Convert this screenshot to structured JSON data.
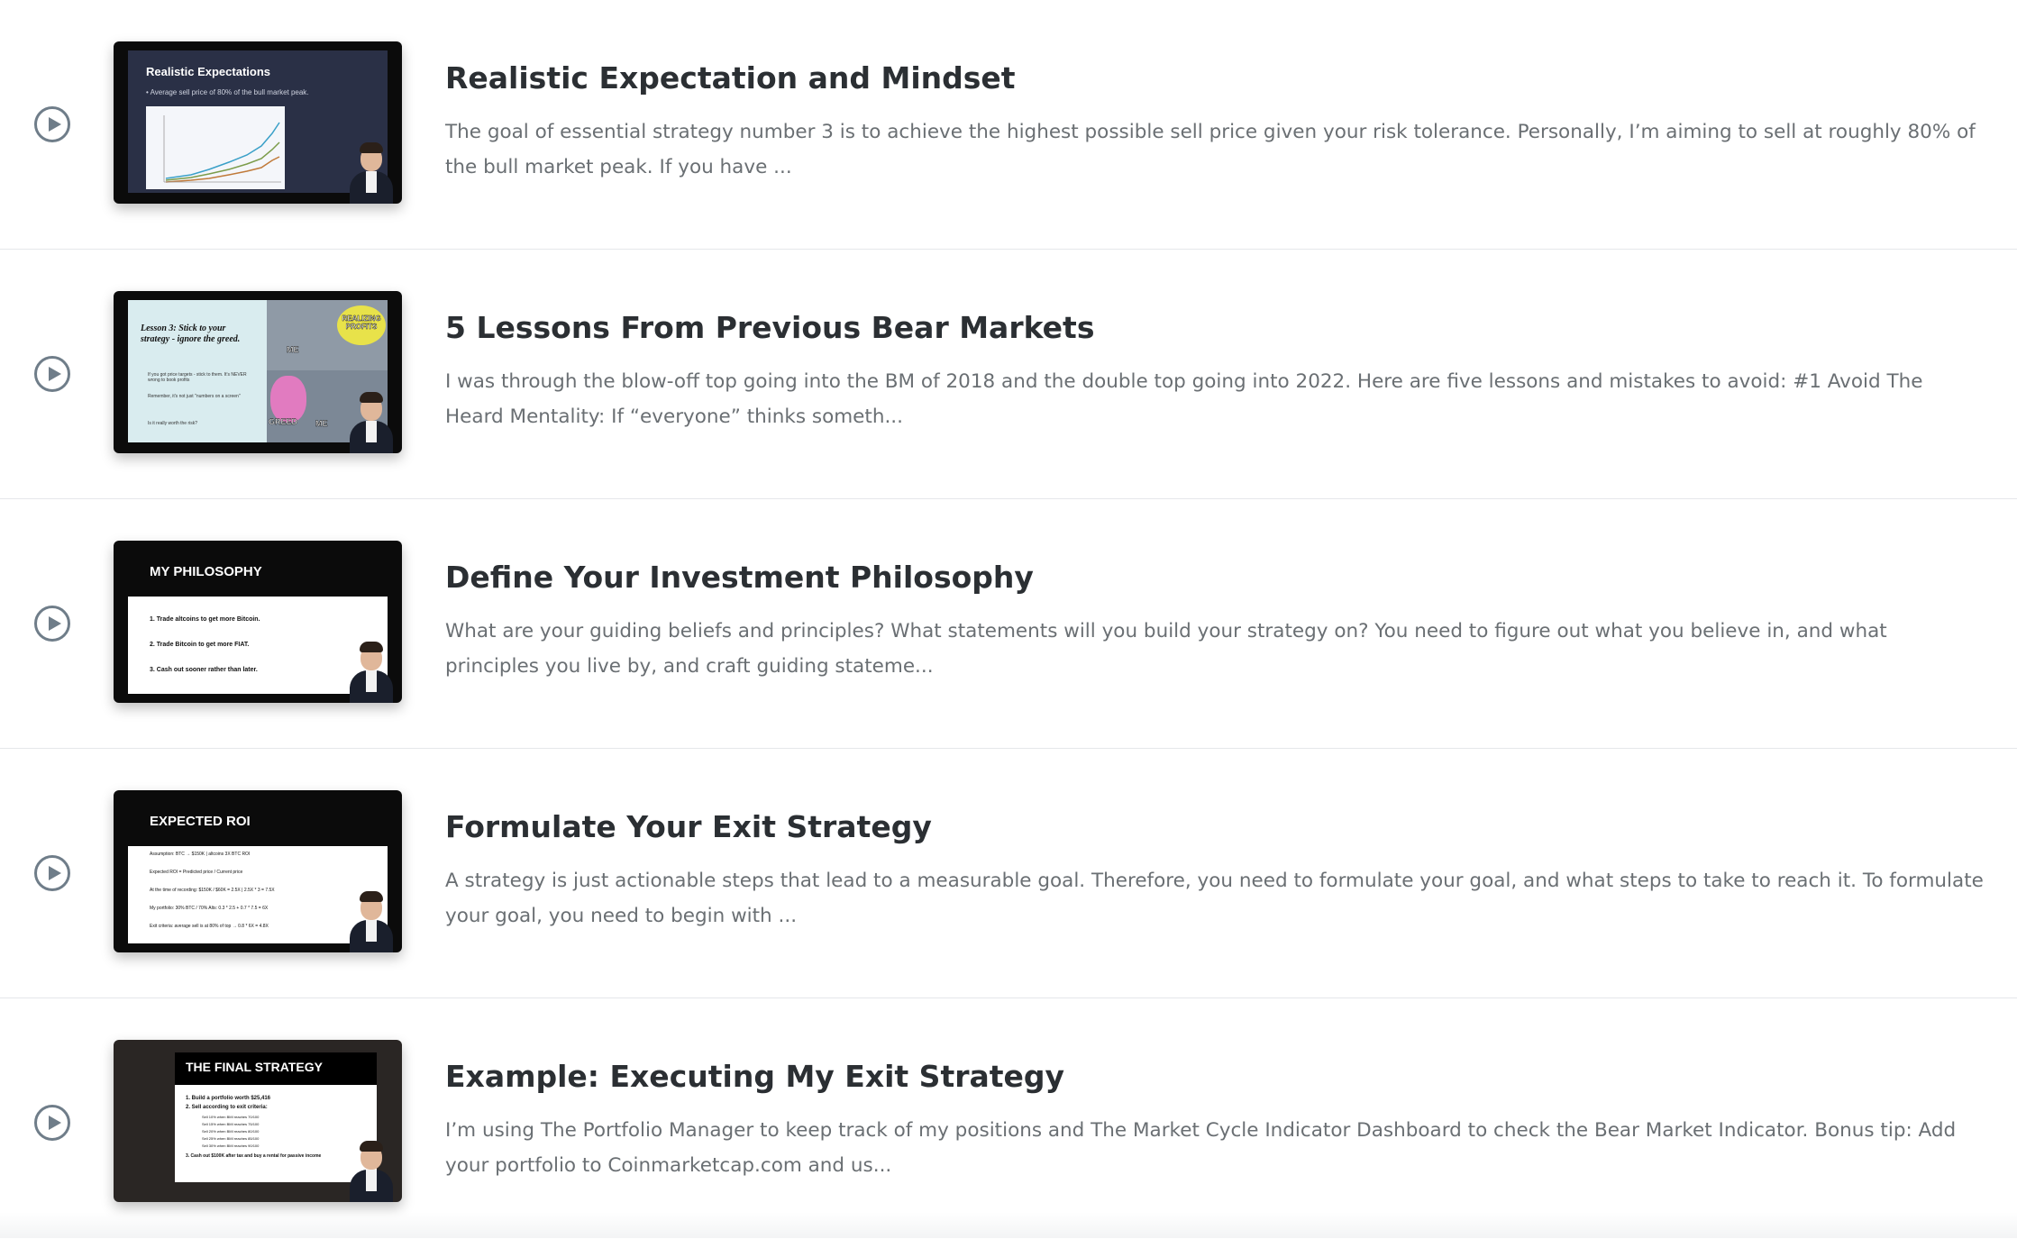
{
  "lessons": [
    {
      "title": "Realistic Expectation and Mindset",
      "description": "The goal of essential strategy number 3 is to achieve the highest possible sell price given your risk tolerance.  Personally, I’m aiming to sell at roughly 80% of the bull market peak. If you have ...",
      "thumbnail": {
        "heading": "Realistic Expectations",
        "bullets": [
          "• Average sell price of 80% of the bull market peak."
        ]
      }
    },
    {
      "title": "5 Lessons From Previous Bear Markets",
      "description": "I was through the blow-off top going into the BM of 2018 and the double top going into 2022. Here are five lessons and mistakes to avoid:   #1 Avoid The Heard Mentality: If “everyone” thinks someth...",
      "thumbnail": {
        "heading": "Lesson 3: Stick to your strategy - ignore the greed.",
        "bullets": [
          "If you got price targets - stick to them. It's NEVER wrong to book profits",
          "Remember, it's not just \"numbers on a screen\"",
          "Is it really worth the risk?"
        ],
        "meme_labels": [
          "REALIZING PROFITS",
          "ME",
          "GREED",
          "ME"
        ]
      }
    },
    {
      "title": "Define Your Investment Philosophy",
      "description": "What are your guiding beliefs and principles? What statements will you build your strategy on? You need to figure out what you believe in, and what principles you live by, and craft guiding stateme...",
      "thumbnail": {
        "heading": "MY PHILOSOPHY",
        "bullets": [
          "1.  Trade altcoins to get more Bitcoin.",
          "2.  Trade Bitcoin to get more FIAT.",
          "3.  Cash out sooner rather than later."
        ]
      }
    },
    {
      "title": "Formulate Your Exit Strategy",
      "description": "A strategy is just actionable steps that lead to a measurable goal.  Therefore, you need to formulate your goal, and what steps to take to reach it.  To formulate your goal, you need to begin with ...",
      "thumbnail": {
        "heading": "EXPECTED ROI",
        "bullets": [
          "Assumption: BTC → $150K | altcoins 3X BTC ROI",
          "Expected ROI = Predicted price / Current price",
          "At the time of recording: $150K / $60K = 2.5X | 2.5X * 3 = 7.5X",
          "My portfolio: 30% BTC / 70% Alts: 0.3 * 2.5 + 0.7 * 7.5 = 6X",
          "Exit criteria: average sell is at 80% of top → 0.8 * 6X = 4.8X"
        ]
      }
    },
    {
      "title": "Example: Executing My Exit Strategy",
      "description": "I’m using The Portfolio Manager to keep track of my positions and The Market Cycle Indicator Dashboard to check the Bear Market Indicator.  Bonus tip: Add your portfolio to Coinmarketcap.com and us...",
      "thumbnail": {
        "heading": "THE FINAL STRATEGY",
        "bullets": [
          "1.  Build a portfolio worth $25,416",
          "2.  Sell according to exit  criteria:",
          "Sell 10% when BMI reaches 70/100",
          "Sell 15% when BMI reaches 75/100",
          "Sell 20% when BMI reaches 80/100",
          "Sell 25% when BMI reaches 85/100",
          "Sell 30% when BMI reaches 90/100",
          "3.  Cash out $100K after tax and buy a rental for passive income"
        ]
      }
    }
  ]
}
